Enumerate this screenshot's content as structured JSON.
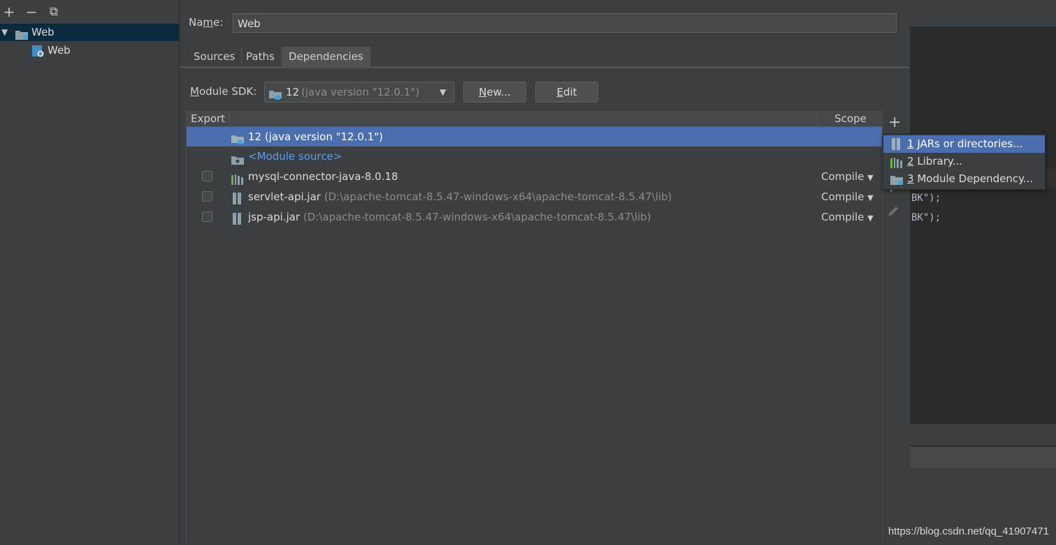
{
  "toolbar": {
    "add": "+",
    "remove": "−",
    "copy": "⧉"
  },
  "tree": [
    {
      "label": "Web",
      "expanded": true
    },
    {
      "label": "Web"
    }
  ],
  "name_field": {
    "label": "Name:",
    "value": "Web"
  },
  "tabs": [
    "Sources",
    "Paths",
    "Dependencies"
  ],
  "active_tab": "Dependencies",
  "module_sdk": {
    "label": "Module SDK:",
    "value_main": "12",
    "value_detail": "(java version \"12.0.1\")"
  },
  "buttons": {
    "new": "New...",
    "edit": "Edit"
  },
  "table": {
    "headers": {
      "export": "Export",
      "scope": "Scope"
    },
    "rows": [
      {
        "name": "12 (java version \"12.0.1\")",
        "path": "",
        "scope": "",
        "checkbox": false,
        "selected": true
      },
      {
        "name": "<Module source>",
        "path": "",
        "scope": "",
        "checkbox": false
      },
      {
        "name": "mysql-connector-java-8.0.18",
        "path": "",
        "scope": "Compile",
        "checkbox": true
      },
      {
        "name": "servlet-api.jar",
        "path": "(D:\\apache-tomcat-8.5.47-windows-x64\\apache-tomcat-8.5.47\\lib)",
        "scope": "Compile",
        "checkbox": true
      },
      {
        "name": "jsp-api.jar",
        "path": "(D:\\apache-tomcat-8.5.47-windows-x64\\apache-tomcat-8.5.47\\lib)",
        "scope": "Compile",
        "checkbox": true
      }
    ]
  },
  "side_tools": {
    "add": "+"
  },
  "popup": {
    "items": [
      {
        "key": "1",
        "label": "JARs or directories..."
      },
      {
        "key": "2",
        "label": "Library..."
      },
      {
        "key": "3",
        "label": "Module Dependency..."
      }
    ]
  },
  "editor_code": [
    "BK\");",
    "BK\");"
  ],
  "watermark": "https://blog.csdn.net/qq_41907471",
  "colors": {
    "selection": "#4b6eaf",
    "background": "#3c3f41",
    "link": "#589df6"
  }
}
